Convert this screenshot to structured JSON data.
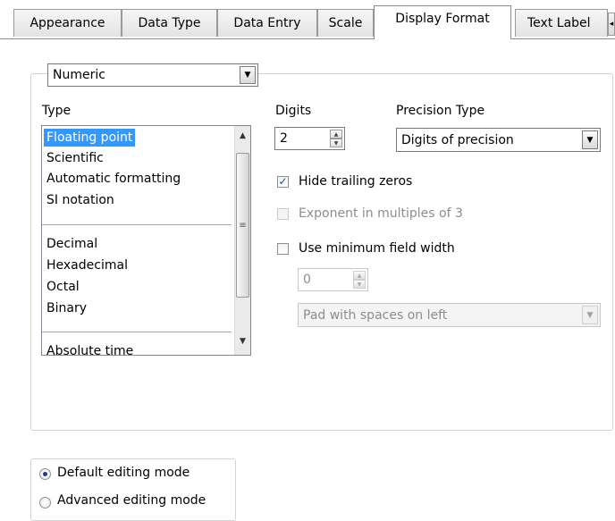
{
  "tabs": [
    "Appearance",
    "Data Type",
    "Data Entry",
    "Scale",
    "Display Format",
    "Text Label"
  ],
  "active_tab": "Display Format",
  "format_select": {
    "value": "Numeric"
  },
  "type_section": {
    "label": "Type",
    "items": [
      {
        "label": "Floating point",
        "selected": true
      },
      {
        "label": "Scientific"
      },
      {
        "label": "Automatic formatting"
      },
      {
        "label": "SI notation"
      },
      {
        "label": "Decimal"
      },
      {
        "label": "Hexadecimal"
      },
      {
        "label": "Octal"
      },
      {
        "label": "Binary"
      },
      {
        "label": "Absolute time"
      }
    ]
  },
  "digits": {
    "label": "Digits",
    "value": "2"
  },
  "precision_type": {
    "label": "Precision Type",
    "value": "Digits of precision"
  },
  "options": {
    "hide_trailing_zeros": {
      "label": "Hide trailing zeros",
      "checked": true
    },
    "exponent_multiples": {
      "label": "Exponent in multiples of 3",
      "checked": false,
      "disabled": true
    },
    "min_field_width": {
      "label": "Use minimum field width",
      "checked": false
    }
  },
  "min_width_value": "0",
  "pad_select": {
    "value": "Pad with spaces on left",
    "disabled": true
  },
  "editing_mode": {
    "options": [
      {
        "label": "Default editing mode",
        "selected": true
      },
      {
        "label": "Advanced editing mode",
        "selected": false
      }
    ]
  }
}
